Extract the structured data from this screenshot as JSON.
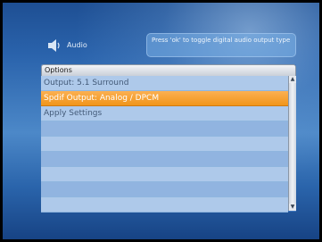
{
  "header": {
    "title": "Audio",
    "icon": "speaker-icon"
  },
  "hint": {
    "text": "Press 'ok' to toggle digital audio output type"
  },
  "options": {
    "header": "Options",
    "items": [
      {
        "label": "Output: 5.1 Surround",
        "selected": false
      },
      {
        "label": "Spdif Output: Analog / DPCM",
        "selected": true
      },
      {
        "label": "Apply Settings",
        "selected": false
      },
      {
        "label": "",
        "selected": false
      },
      {
        "label": "",
        "selected": false
      },
      {
        "label": "",
        "selected": false
      },
      {
        "label": "",
        "selected": false
      },
      {
        "label": "",
        "selected": false
      },
      {
        "label": "",
        "selected": false
      }
    ]
  },
  "colors": {
    "selection": "#f39a1f",
    "row_light": "#aec9ea",
    "row_dark": "#91b4e0",
    "background": "#2a63ac"
  }
}
